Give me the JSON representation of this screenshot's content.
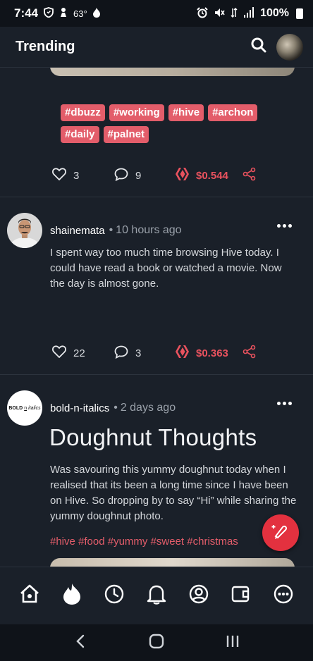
{
  "status_bar": {
    "time": "7:44",
    "temperature": "63°",
    "battery": "100%"
  },
  "header": {
    "title": "Trending",
    "search_icon": "search-icon",
    "avatar": "user-avatar"
  },
  "posts": [
    {
      "tags": [
        "#dbuzz",
        "#working",
        "#hive",
        "#archon",
        "#daily",
        "#palnet"
      ],
      "likes": "3",
      "comments": "9",
      "payout": "$0.544"
    },
    {
      "author": "shainemata",
      "separator": "•",
      "time": "10 hours ago",
      "body": "I spent way too much time browsing Hive today. I could have read a book or watched a movie. Now the day is almost gone.",
      "likes": "22",
      "comments": "3",
      "payout": "$0.363"
    },
    {
      "author": "bold-n-italics",
      "avatar_text_bold": "BOLD",
      "avatar_text_n": "n",
      "avatar_text_italics": "italics",
      "separator": "•",
      "time": "2 days ago",
      "title": "Doughnut Thoughts",
      "body": "Was savouring this yummy doughnut today when I realised that its been a long time since I have been on Hive. So dropping by to say “Hi” while sharing the yummy doughnut photo.",
      "hashtags": "#hive #food #yummy #sweet #christmas"
    }
  ],
  "colors": {
    "background": "#1a2029",
    "accent": "#e35d6a",
    "payout": "#e9525e",
    "fab": "#e3313f"
  },
  "bottom_nav": [
    "home-icon",
    "trending-flame-icon",
    "clock-icon",
    "bell-icon",
    "profile-icon",
    "wallet-icon",
    "more-icon"
  ],
  "system_nav": [
    "back-icon",
    "home-circle-icon",
    "recents-icon"
  ]
}
